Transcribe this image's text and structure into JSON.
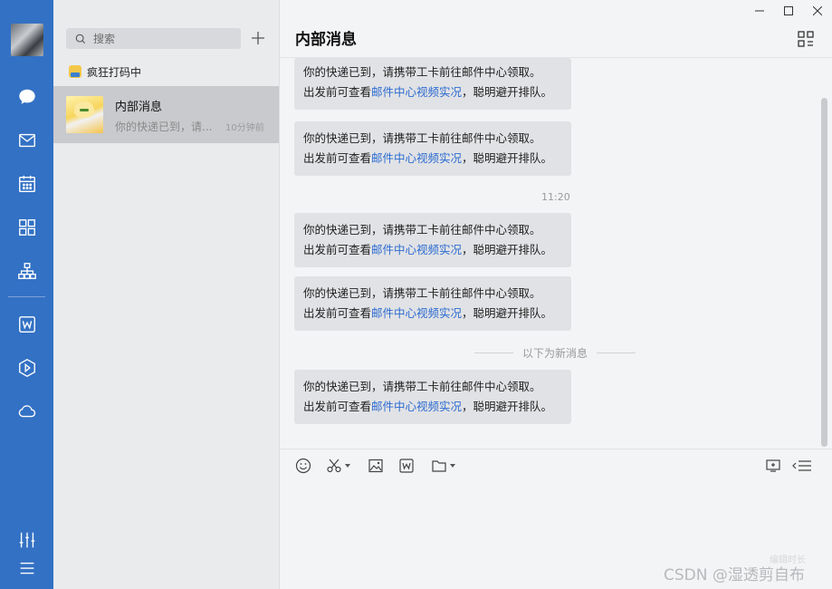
{
  "rail": {
    "icons": [
      "avatar",
      "chat-icon",
      "mail-icon",
      "calendar-icon",
      "apps-icon",
      "org-chart-icon",
      "doc-w-icon",
      "drive-icon",
      "cloud-icon",
      "settings-sliders-icon",
      "menu-icon"
    ]
  },
  "list": {
    "search_placeholder": "搜索",
    "status_text": "疯狂打码中",
    "conversation": {
      "name": "内部消息",
      "preview": "你的快递已到，请...",
      "time": "10分钟前"
    }
  },
  "chat": {
    "title": "内部消息",
    "time_label": "11:20",
    "new_messages_label": "以下为新消息",
    "message": {
      "line1": "你的快递已到，请携带工卡前往邮件中心领取。",
      "line2_prefix": "出发前可查看",
      "line2_link": "邮件中心视频实况",
      "line2_suffix": "，聪明避开排队。"
    }
  },
  "watermark": {
    "text": "CSDN @湿透剪自布",
    "faded": "编辑时长"
  },
  "colors": {
    "rail": "#3371c4",
    "link": "#2d6cd1"
  }
}
